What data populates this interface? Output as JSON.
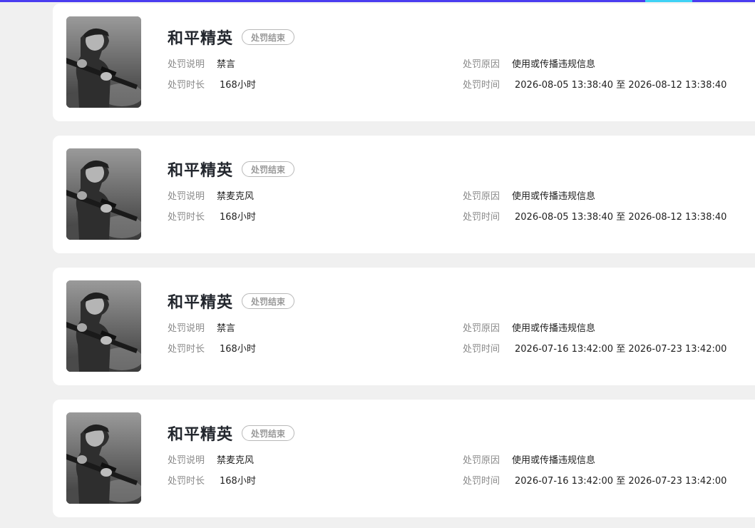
{
  "colors": {
    "page_background": "#f0f0f0",
    "card_background": "#ffffff",
    "top_bar": "#4a3df0",
    "top_bar_highlight": "#3fd2f5",
    "title_text": "#23272e",
    "label_text": "#8a8a8a",
    "value_text": "#1f1f1f",
    "badge_border": "#b8b8b8"
  },
  "records": [
    {
      "thumbnail_icon": "game-cover-soldier-grayscale",
      "game_title": "和平精英",
      "status": "处罚结束",
      "description_label": "处罚说明",
      "description_value": "禁言",
      "duration_label": "处罚时长",
      "duration_value": "168小时",
      "reason_label": "处罚原因",
      "reason_value": "使用或传播违规信息",
      "time_label": "处罚时间",
      "time_value": "2026-08-05 13:38:40 至 2026-08-12 13:38:40"
    },
    {
      "thumbnail_icon": "game-cover-soldier-grayscale",
      "game_title": "和平精英",
      "status": "处罚结束",
      "description_label": "处罚说明",
      "description_value": "禁麦克风",
      "duration_label": "处罚时长",
      "duration_value": "168小时",
      "reason_label": "处罚原因",
      "reason_value": "使用或传播违规信息",
      "time_label": "处罚时间",
      "time_value": "2026-08-05 13:38:40 至 2026-08-12 13:38:40"
    },
    {
      "thumbnail_icon": "game-cover-soldier-grayscale",
      "game_title": "和平精英",
      "status": "处罚结束",
      "description_label": "处罚说明",
      "description_value": "禁言",
      "duration_label": "处罚时长",
      "duration_value": "168小时",
      "reason_label": "处罚原因",
      "reason_value": "使用或传播违规信息",
      "time_label": "处罚时间",
      "time_value": "2026-07-16 13:42:00 至 2026-07-23 13:42:00"
    },
    {
      "thumbnail_icon": "game-cover-soldier-grayscale",
      "game_title": "和平精英",
      "status": "处罚结束",
      "description_label": "处罚说明",
      "description_value": "禁麦克风",
      "duration_label": "处罚时长",
      "duration_value": "168小时",
      "reason_label": "处罚原因",
      "reason_value": "使用或传播违规信息",
      "time_label": "处罚时间",
      "time_value": "2026-07-16 13:42:00 至 2026-07-23 13:42:00"
    }
  ]
}
